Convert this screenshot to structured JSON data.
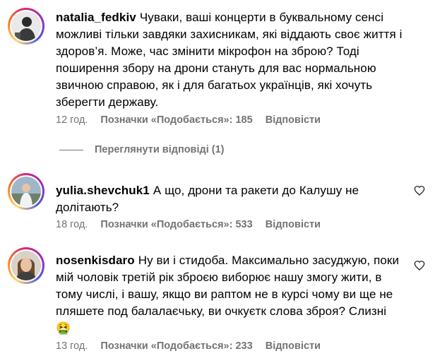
{
  "comments": [
    {
      "username": "natalia_fedkiv",
      "text": "Чуваки, ваші концерти в буквальному сенсі можливі тільки завдяки захисникам, які віддають своє життя і здоров’я. Може, час змінити мікрофон на зброю? Тоді поширення збору на дрони стануть для вас нормальною звичною справою, як і для багатьох українців, які хочуть зберегти державу.",
      "time": "12 год.",
      "likes": "Позначки «Подобається»: 185",
      "reply": "Відповісти",
      "avatar_icon": "user-avatar"
    },
    {
      "username": "yulia.shevchuk1",
      "text": "А що, дрони та ракети до Калушу не долітають?",
      "time": "18 год.",
      "likes": "Позначки «Подобається»: 533",
      "reply": "Відповісти",
      "avatar_icon": "user-avatar"
    },
    {
      "username": "nosenkisdaro",
      "text": "Ну ви і стидоба. Максимально засуджую, поки мій чоловік третій рік зброєю виборює нашу змогу жити, в тому числі, і вашу, якщо ви раптом не в курсі чому ви ще не пляшете под балалаєчьку, ви очкуєтк слова зброя? Слизні",
      "emoji": "🤮",
      "time": "13 год.",
      "likes": "Позначки «Подобається»: 233",
      "reply": "Відповісти",
      "avatar_icon": "user-avatar"
    }
  ],
  "view_replies": "Переглянути відповіді (1)",
  "colors": {
    "meta": "#737373",
    "text": "#000000"
  }
}
